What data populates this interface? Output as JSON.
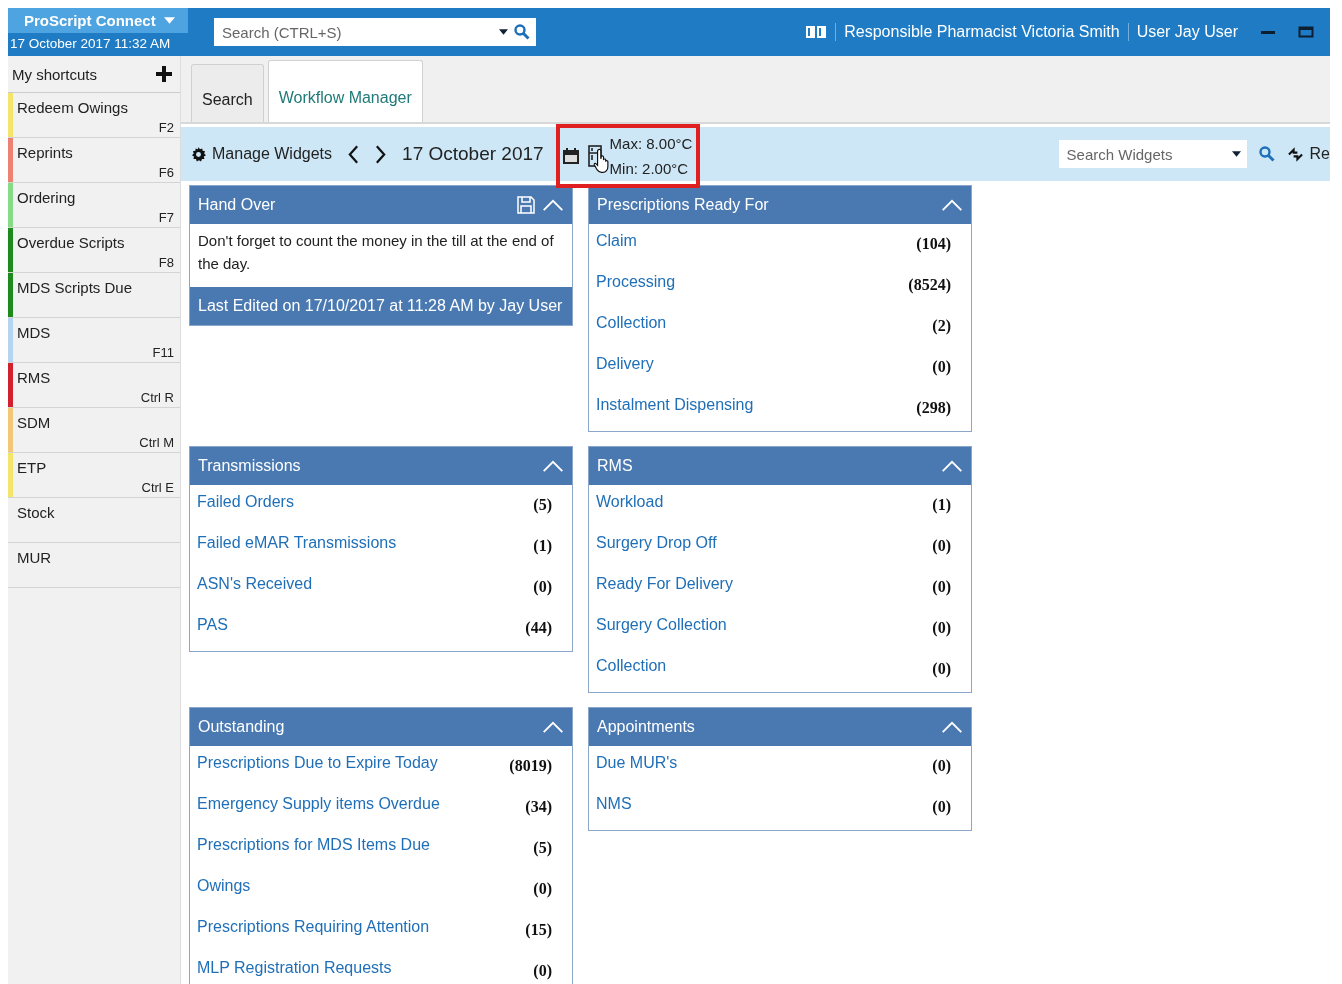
{
  "app": {
    "title": "ProScript Connect",
    "datetime": "17 October 2017 11:32 AM"
  },
  "search": {
    "placeholder": "Search (CTRL+S)"
  },
  "header": {
    "pharmacist": "Responsible Pharmacist Victoria Smith",
    "user": "User Jay User"
  },
  "shortcuts": {
    "title": "My shortcuts",
    "items": [
      {
        "label": "Redeem Owings",
        "key": "F2",
        "color": "#f3e46c"
      },
      {
        "label": "Reprints",
        "key": "F6",
        "color": "#ee8272"
      },
      {
        "label": "Ordering",
        "key": "F7",
        "color": "#86dc86"
      },
      {
        "label": "Overdue Scripts",
        "key": "F8",
        "color": "#1e8a1e"
      },
      {
        "label": "MDS Scripts Due",
        "color": "#1e8a1e"
      },
      {
        "label": "MDS",
        "key": "F11",
        "color": "#b4d4f2"
      },
      {
        "label": "RMS",
        "key": "Ctrl R",
        "color": "#d2202e"
      },
      {
        "label": "SDM",
        "key": "Ctrl M",
        "color": "#f2c878"
      },
      {
        "label": "ETP",
        "key": "Ctrl E",
        "color": "#f3e46c"
      },
      {
        "label": "Stock"
      },
      {
        "label": "MUR"
      }
    ]
  },
  "tabs": [
    {
      "label": "Search",
      "selected": false
    },
    {
      "label": "Workflow Manager",
      "selected": true
    }
  ],
  "toolbar": {
    "manage": "Manage Widgets",
    "date": "17 October 2017",
    "max": "Max: 8.00°C",
    "min": "Min: 2.00°C",
    "search_placeholder": "Search Widgets",
    "refresh": "Re"
  },
  "widgets": [
    {
      "kind": "note",
      "title": "Hand Over",
      "text": "Don't forget to count the money in the till at the end of the day.",
      "footer": "Last Edited on 17/10/2017 at 11:28 AM by Jay User"
    },
    {
      "kind": "list",
      "title": "Prescriptions Ready For",
      "rows": [
        {
          "label": "Claim",
          "count": "(104)"
        },
        {
          "label": "Processing",
          "count": "(8524)"
        },
        {
          "label": "Collection",
          "count": "(2)"
        },
        {
          "label": "Delivery",
          "count": "(0)"
        },
        {
          "label": "Instalment Dispensing",
          "count": "(298)"
        }
      ]
    },
    {
      "kind": "list",
      "title": "Transmissions",
      "rows": [
        {
          "label": "Failed Orders",
          "count": "(5)"
        },
        {
          "label": "Failed eMAR Transmissions",
          "count": "(1)"
        },
        {
          "label": "ASN's Received",
          "count": "(0)"
        },
        {
          "label": "PAS",
          "count": "(44)"
        }
      ]
    },
    {
      "kind": "list",
      "title": "RMS",
      "rows": [
        {
          "label": "Workload",
          "count": "(1)"
        },
        {
          "label": "Surgery Drop Off",
          "count": "(0)"
        },
        {
          "label": "Ready For Delivery",
          "count": "(0)"
        },
        {
          "label": "Surgery Collection",
          "count": "(0)"
        },
        {
          "label": "Collection",
          "count": "(0)"
        }
      ]
    },
    {
      "kind": "list",
      "title": "Outstanding",
      "rows": [
        {
          "label": "Prescriptions Due to Expire Today",
          "count": "(8019)"
        },
        {
          "label": "Emergency Supply items Overdue",
          "count": "(34)"
        },
        {
          "label": "Prescriptions for MDS Items Due",
          "count": "(5)"
        },
        {
          "label": "Owings",
          "count": "(0)"
        },
        {
          "label": "Prescriptions Requiring Attention",
          "count": "(15)"
        },
        {
          "label": "MLP Registration Requests",
          "count": "(0)"
        }
      ]
    },
    {
      "kind": "list",
      "title": "Appointments",
      "rows": [
        {
          "label": "Due MUR's",
          "count": "(0)"
        },
        {
          "label": "NMS",
          "count": "(0)"
        }
      ]
    }
  ]
}
